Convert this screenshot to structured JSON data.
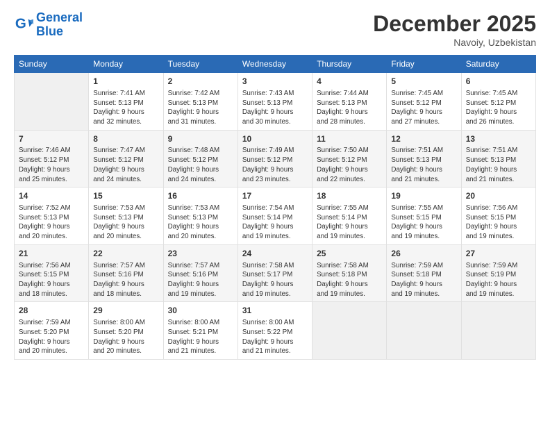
{
  "logo": {
    "line1": "General",
    "line2": "Blue"
  },
  "title": "December 2025",
  "location": "Navoiy, Uzbekistan",
  "days_header": [
    "Sunday",
    "Monday",
    "Tuesday",
    "Wednesday",
    "Thursday",
    "Friday",
    "Saturday"
  ],
  "weeks": [
    [
      {
        "day": "",
        "info": ""
      },
      {
        "day": "1",
        "info": "Sunrise: 7:41 AM\nSunset: 5:13 PM\nDaylight: 9 hours\nand 32 minutes."
      },
      {
        "day": "2",
        "info": "Sunrise: 7:42 AM\nSunset: 5:13 PM\nDaylight: 9 hours\nand 31 minutes."
      },
      {
        "day": "3",
        "info": "Sunrise: 7:43 AM\nSunset: 5:13 PM\nDaylight: 9 hours\nand 30 minutes."
      },
      {
        "day": "4",
        "info": "Sunrise: 7:44 AM\nSunset: 5:13 PM\nDaylight: 9 hours\nand 28 minutes."
      },
      {
        "day": "5",
        "info": "Sunrise: 7:45 AM\nSunset: 5:12 PM\nDaylight: 9 hours\nand 27 minutes."
      },
      {
        "day": "6",
        "info": "Sunrise: 7:45 AM\nSunset: 5:12 PM\nDaylight: 9 hours\nand 26 minutes."
      }
    ],
    [
      {
        "day": "7",
        "info": "Sunrise: 7:46 AM\nSunset: 5:12 PM\nDaylight: 9 hours\nand 25 minutes."
      },
      {
        "day": "8",
        "info": "Sunrise: 7:47 AM\nSunset: 5:12 PM\nDaylight: 9 hours\nand 24 minutes."
      },
      {
        "day": "9",
        "info": "Sunrise: 7:48 AM\nSunset: 5:12 PM\nDaylight: 9 hours\nand 24 minutes."
      },
      {
        "day": "10",
        "info": "Sunrise: 7:49 AM\nSunset: 5:12 PM\nDaylight: 9 hours\nand 23 minutes."
      },
      {
        "day": "11",
        "info": "Sunrise: 7:50 AM\nSunset: 5:12 PM\nDaylight: 9 hours\nand 22 minutes."
      },
      {
        "day": "12",
        "info": "Sunrise: 7:51 AM\nSunset: 5:13 PM\nDaylight: 9 hours\nand 21 minutes."
      },
      {
        "day": "13",
        "info": "Sunrise: 7:51 AM\nSunset: 5:13 PM\nDaylight: 9 hours\nand 21 minutes."
      }
    ],
    [
      {
        "day": "14",
        "info": "Sunrise: 7:52 AM\nSunset: 5:13 PM\nDaylight: 9 hours\nand 20 minutes."
      },
      {
        "day": "15",
        "info": "Sunrise: 7:53 AM\nSunset: 5:13 PM\nDaylight: 9 hours\nand 20 minutes."
      },
      {
        "day": "16",
        "info": "Sunrise: 7:53 AM\nSunset: 5:13 PM\nDaylight: 9 hours\nand 20 minutes."
      },
      {
        "day": "17",
        "info": "Sunrise: 7:54 AM\nSunset: 5:14 PM\nDaylight: 9 hours\nand 19 minutes."
      },
      {
        "day": "18",
        "info": "Sunrise: 7:55 AM\nSunset: 5:14 PM\nDaylight: 9 hours\nand 19 minutes."
      },
      {
        "day": "19",
        "info": "Sunrise: 7:55 AM\nSunset: 5:15 PM\nDaylight: 9 hours\nand 19 minutes."
      },
      {
        "day": "20",
        "info": "Sunrise: 7:56 AM\nSunset: 5:15 PM\nDaylight: 9 hours\nand 19 minutes."
      }
    ],
    [
      {
        "day": "21",
        "info": "Sunrise: 7:56 AM\nSunset: 5:15 PM\nDaylight: 9 hours\nand 18 minutes."
      },
      {
        "day": "22",
        "info": "Sunrise: 7:57 AM\nSunset: 5:16 PM\nDaylight: 9 hours\nand 18 minutes."
      },
      {
        "day": "23",
        "info": "Sunrise: 7:57 AM\nSunset: 5:16 PM\nDaylight: 9 hours\nand 19 minutes."
      },
      {
        "day": "24",
        "info": "Sunrise: 7:58 AM\nSunset: 5:17 PM\nDaylight: 9 hours\nand 19 minutes."
      },
      {
        "day": "25",
        "info": "Sunrise: 7:58 AM\nSunset: 5:18 PM\nDaylight: 9 hours\nand 19 minutes."
      },
      {
        "day": "26",
        "info": "Sunrise: 7:59 AM\nSunset: 5:18 PM\nDaylight: 9 hours\nand 19 minutes."
      },
      {
        "day": "27",
        "info": "Sunrise: 7:59 AM\nSunset: 5:19 PM\nDaylight: 9 hours\nand 19 minutes."
      }
    ],
    [
      {
        "day": "28",
        "info": "Sunrise: 7:59 AM\nSunset: 5:20 PM\nDaylight: 9 hours\nand 20 minutes."
      },
      {
        "day": "29",
        "info": "Sunrise: 8:00 AM\nSunset: 5:20 PM\nDaylight: 9 hours\nand 20 minutes."
      },
      {
        "day": "30",
        "info": "Sunrise: 8:00 AM\nSunset: 5:21 PM\nDaylight: 9 hours\nand 21 minutes."
      },
      {
        "day": "31",
        "info": "Sunrise: 8:00 AM\nSunset: 5:22 PM\nDaylight: 9 hours\nand 21 minutes."
      },
      {
        "day": "",
        "info": ""
      },
      {
        "day": "",
        "info": ""
      },
      {
        "day": "",
        "info": ""
      }
    ]
  ]
}
